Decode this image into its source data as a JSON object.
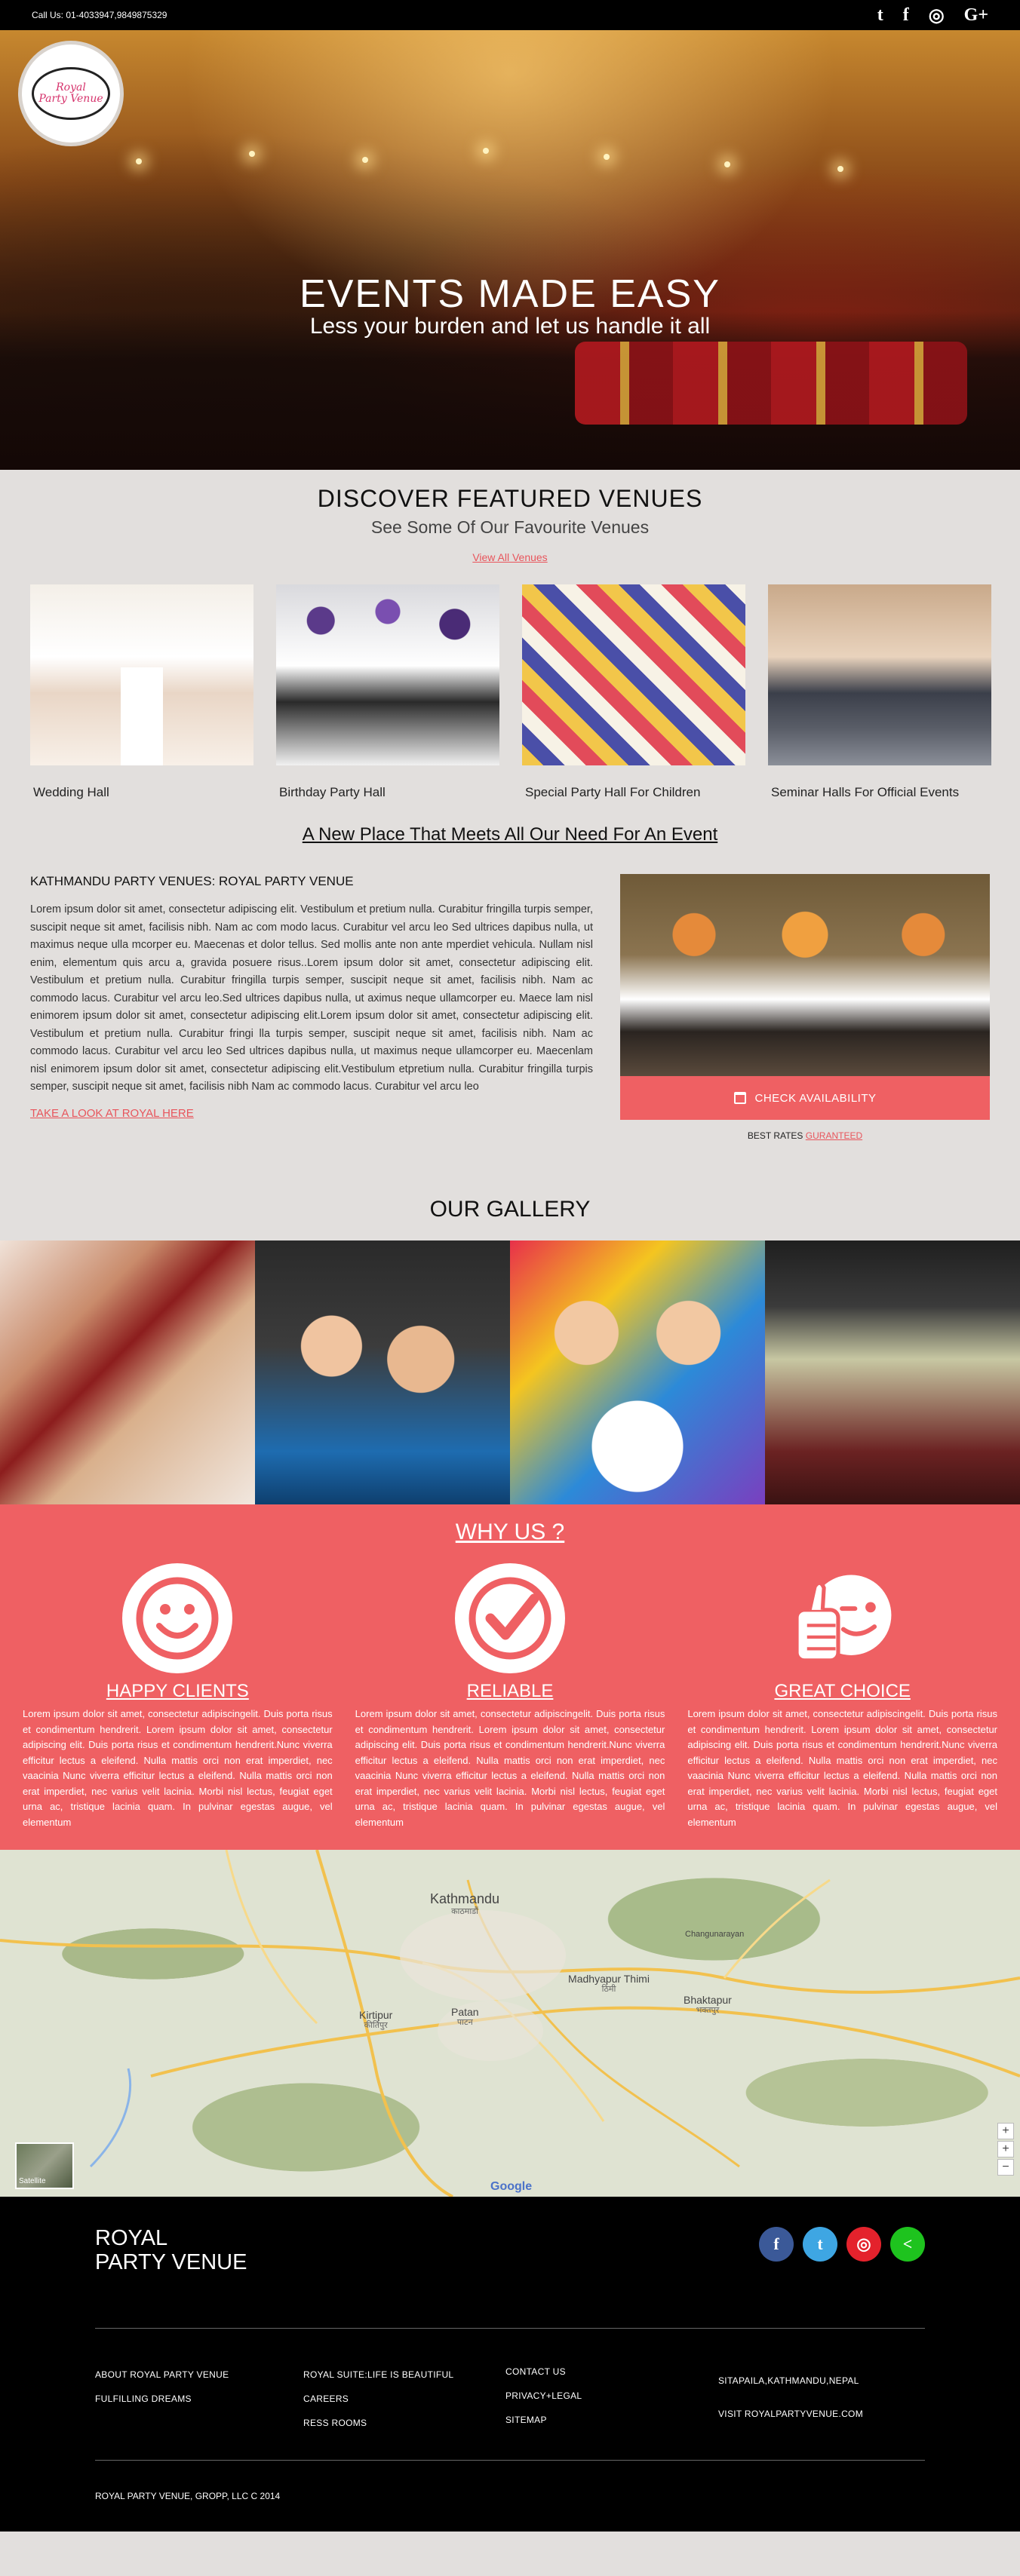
{
  "topbar": {
    "phone": "Call Us: 01-4033947,9849875329",
    "social": [
      {
        "icon": "twitter-icon",
        "glyph": "t"
      },
      {
        "icon": "facebook-icon",
        "glyph": "f"
      },
      {
        "icon": "instagram-icon",
        "glyph": "◎"
      },
      {
        "icon": "google-plus-icon",
        "glyph": "G+"
      }
    ]
  },
  "hero": {
    "logo_line1": "Royal",
    "logo_line2": "Party Venue",
    "title": "EVENTS MADE EASY",
    "subtitle": "Less  your burden and let us handle it all"
  },
  "featured": {
    "title": "DISCOVER FEATURED VENUES",
    "subtitle": "See Some Of Our Favourite Venues",
    "view_all": "View All Venues",
    "venues": [
      {
        "label": "Wedding Hall"
      },
      {
        "label": "Birthday Party Hall"
      },
      {
        "label": "Special Party Hall For Children"
      },
      {
        "label": "Seminar Halls For Official Events"
      }
    ]
  },
  "about": {
    "headline": "A New Place That Meets All Our Need For An Event",
    "title": "KATHMANDU PARTY VENUES: ROYAL PARTY VENUE",
    "body": "Lorem ipsum dolor sit amet, consectetur adipiscing elit. Vestibulum et pretium nulla. Curabitur fringilla turpis semper, suscipit neque sit amet, facilisis nibh. Nam ac com modo lacus. Curabitur vel arcu leo Sed ultrices dapibus nulla, ut maximus neque ulla mcorper eu. Maecenas et dolor tellus. Sed mollis ante non ante  mperdiet vehicula. Nullam nisl enim, elementum quis arcu a, gravida posuere risus..Lorem ipsum dolor sit amet, consectetur adipiscing elit. Vestibulum et pretium nulla. Curabitur fringilla turpis semper, suscipit neque sit amet, facilisis nibh. Nam ac commodo lacus. Curabitur vel arcu leo.Sed ultrices dapibus nulla, ut aximus neque ullamcorper eu. Maece lam nisl enimorem ipsum dolor sit amet, consectetur adipiscing elit.Lorem ipsum dolor sit amet, consectetur adipiscing elit. Vestibulum et pretium nulla. Curabitur fringi lla turpis semper, suscipit neque sit amet, facilisis nibh. Nam ac commodo lacus. Curabitur vel arcu leo Sed ultrices dapibus nulla, ut maximus neque ullamcorper eu. Maecenlam nisl enimorem ipsum dolor sit amet, consectetur adipiscing elit.Vestibulum etpretium nulla. Curabitur fringilla turpis semper, suscipit neque sit amet, facilisis nibh Nam ac commodo lacus. Curabitur vel arcu leo",
    "link": "TAKE A LOOK AT ROYAL HERE",
    "check_button": "CHECK AVAILABILITY",
    "best_rates": "BEST RATES",
    "guaranteed": "GURANTEED"
  },
  "gallery": {
    "title": "OUR GALLERY"
  },
  "why": {
    "title": "WHY US ?",
    "items": [
      {
        "title": "HAPPY CLIENTS",
        "icon": "smiley-face-icon",
        "text": "Lorem ipsum dolor sit amet, consectetur adipiscingelit.  Duis porta risus et condimentum hendrerit. Lorem ipsum dolor sit amet, consectetur adipiscing elit. Duis porta risus et condimentum hendrerit.Nunc viverra efficitur lectus a eleifend. Nulla mattis orci non erat  imperdiet, nec vaacinia Nunc viverra efficitur lectus a eleifend. Nulla mattis orci non erat imperdiet, nec varius velit lacinia. Morbi nisl lectus, feugiat eget urna ac, tristique lacinia quam. In pulvinar egestas augue, vel elementum"
      },
      {
        "title": "RELIABLE",
        "icon": "checkmark-icon",
        "text": "Lorem ipsum dolor sit amet, consectetur adipiscingelit.  Duis porta risus et condimentum hendrerit. Lorem ipsum dolor sit amet, consectetur adipiscing elit. Duis porta risus et condimentum hendrerit.Nunc viverra efficitur lectus a eleifend. Nulla mattis orci non erat  imperdiet, nec vaacinia Nunc viverra efficitur lectus a eleifend. Nulla mattis orci non erat imperdiet, nec varius velit lacinia. Morbi nisl lectus, feugiat eget urna ac, tristique lacinia quam. In pulvinar egestas augue, vel elementum"
      },
      {
        "title": "GREAT CHOICE",
        "icon": "thumbs-up-wink-icon",
        "text": "Lorem ipsum dolor sit amet, consectetur adipiscingelit.  Duis porta risus et condimentum hendrerit. Lorem ipsum dolor sit amet, consectetur adipiscing elit. Duis porta risus et condimentum hendrerit.Nunc viverra efficitur lectus a eleifend. Nulla mattis orci non erat  imperdiet, nec vaacinia Nunc viverra efficitur lectus a eleifend. Nulla mattis orci non erat imperdiet, nec varius velit lacinia. Morbi nisl lectus, feugiat eget urna ac, tristique lacinia quam. In pulvinar egestas augue, vel elementum"
      }
    ]
  },
  "map": {
    "kathmandu": "Kathmandu",
    "kathmandu_np": "काठमाडौं",
    "kirtipur": "Kirtipur",
    "kirtipur_np": "कीर्तिपुर",
    "patan": "Patan",
    "patan_np": "पाटन",
    "madhyapur": "Madhyapur Thimi",
    "madhyapur_np": "ठिमी",
    "bhaktapur": "Bhaktapur",
    "bhaktapur_np": "भक्तपुर",
    "changunarayan": "Changunarayan",
    "satellite": "Satellite",
    "google": "Google"
  },
  "footer": {
    "brand_line1": "ROYAL",
    "brand_line2": "PARTY VENUE",
    "social": [
      {
        "icon": "facebook-icon",
        "glyph": "f",
        "color": "#3b5998"
      },
      {
        "icon": "twitter-icon",
        "glyph": "t",
        "color": "#3ea6e3"
      },
      {
        "icon": "instagram-icon",
        "glyph": "◎",
        "color": "#e4222c"
      },
      {
        "icon": "share-icon",
        "glyph": "<",
        "color": "#1ec31e"
      }
    ],
    "col1": [
      "ABOUT ROYAL PARTY VENUE",
      "FULFILLING DREAMS"
    ],
    "col2": [
      "ROYAL SUITE:LIFE IS BEAUTIFUL",
      "CAREERS",
      "RESS ROOMS"
    ],
    "col3": [
      "CONTACT US",
      "PRIVACY+LEGAL",
      "SITEMAP"
    ],
    "col4": [
      "SITAPAILA,KATHMANDU,NEPAL",
      "VISIT ROYALPARTYVENUE.COM"
    ],
    "copyright": "ROYAL PARTY VENUE, GROPP, LLC C 2014"
  }
}
